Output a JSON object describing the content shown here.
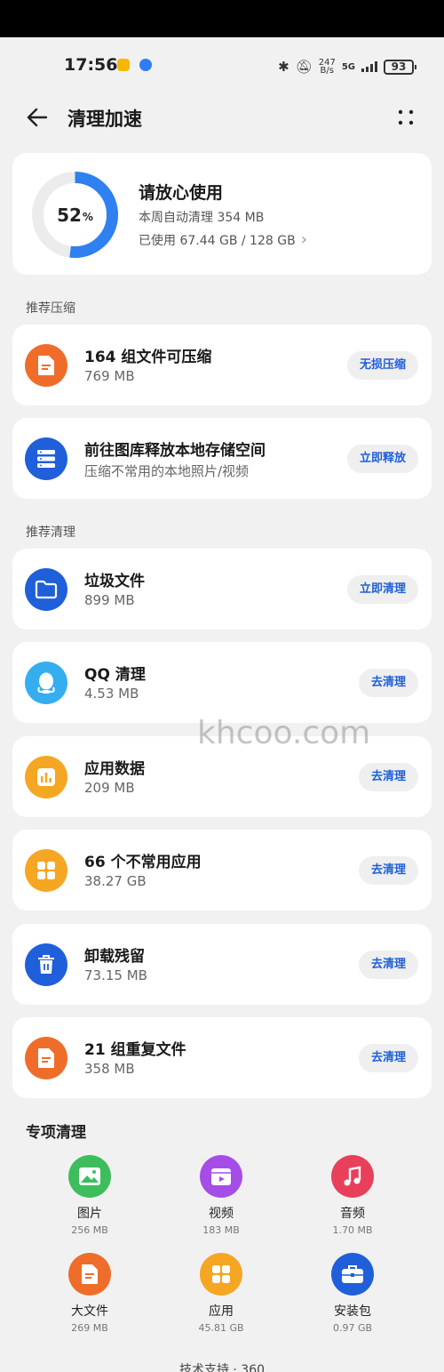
{
  "status": {
    "time": "17:56",
    "net_speed_top": "247",
    "net_speed_bottom": "B/s",
    "network": "5G",
    "battery": "93"
  },
  "header": {
    "title": "清理加速"
  },
  "summary": {
    "percent": 52,
    "percent_number": "52",
    "percent_unit": "%",
    "title": "请放心使用",
    "auto_clean": "本周自动清理 354 MB",
    "usage": "已使用 67.44 GB / 128 GB"
  },
  "sections": {
    "compress": "推荐压缩",
    "clean": "推荐清理",
    "special": "专项清理"
  },
  "compress_items": [
    {
      "title": "164 组文件可压缩",
      "sub": "769 MB",
      "button": "无损压缩",
      "icon": "document-icon",
      "color": "#ef6d2a"
    },
    {
      "title": "前往图库释放本地存储空间",
      "sub": "压缩不常用的本地照片/视频",
      "button": "立即释放",
      "icon": "storage-icon",
      "color": "#1f5fd9"
    }
  ],
  "clean_items": [
    {
      "title": "垃圾文件",
      "sub": "899 MB",
      "button": "立即清理",
      "icon": "folder-icon",
      "color": "#1f5fd9"
    },
    {
      "title": "QQ 清理",
      "sub": "4.53 MB",
      "button": "去清理",
      "icon": "qq-icon",
      "color": "#35aef0"
    },
    {
      "title": "应用数据",
      "sub": "209 MB",
      "button": "去清理",
      "icon": "bar-chart-icon",
      "color": "#f5a623"
    },
    {
      "title": "66 个不常用应用",
      "sub": "38.27 GB",
      "button": "去清理",
      "icon": "apps-grid-icon",
      "color": "#f5a623"
    },
    {
      "title": "卸载残留",
      "sub": "73.15 MB",
      "button": "去清理",
      "icon": "trash-icon",
      "color": "#1f5fd9"
    },
    {
      "title": "21 组重复文件",
      "sub": "358 MB",
      "button": "去清理",
      "icon": "document-icon",
      "color": "#ef6d2a"
    }
  ],
  "special_items": [
    {
      "label": "图片",
      "size": "256 MB",
      "icon": "image-icon",
      "color": "#3dbd5c"
    },
    {
      "label": "视频",
      "size": "183 MB",
      "icon": "video-icon",
      "color": "#a64de8"
    },
    {
      "label": "音频",
      "size": "1.70 MB",
      "icon": "music-icon",
      "color": "#e8405a"
    },
    {
      "label": "大文件",
      "size": "269 MB",
      "icon": "document-icon",
      "color": "#ef6d2a"
    },
    {
      "label": "应用",
      "size": "45.81 GB",
      "icon": "apps-grid-icon",
      "color": "#f5a623"
    },
    {
      "label": "安装包",
      "size": "0.97 GB",
      "icon": "briefcase-icon",
      "color": "#1f5fd9"
    }
  ],
  "watermark": "khcoo.com",
  "footer": "技术支持 · 360"
}
